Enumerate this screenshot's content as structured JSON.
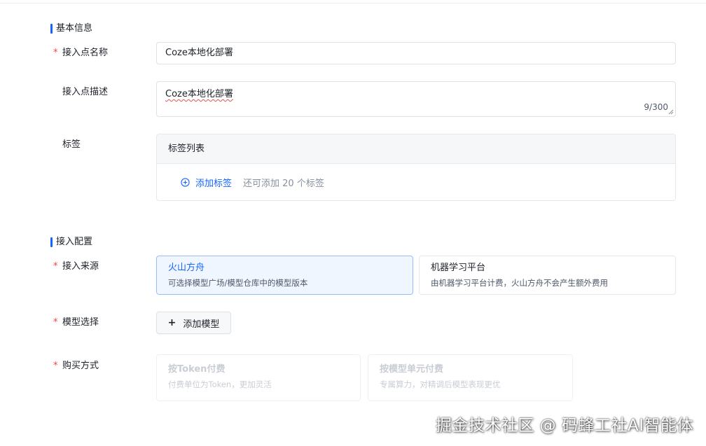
{
  "basic": {
    "section_title": "基本信息",
    "name_label": "接入点名称",
    "name_value": "Coze本地化部署",
    "desc_label": "接入点描述",
    "desc_value": "Coze本地化部署",
    "desc_counter": "9/300",
    "tags_label": "标签",
    "tags_list_header": "标签列表",
    "add_tag_label": "添加标签",
    "tag_hint": "还可添加 20 个标签"
  },
  "config": {
    "section_title": "接入配置",
    "source_label": "接入来源",
    "sources": [
      {
        "title": "火山方舟",
        "desc": "可选择模型广场/模型仓库中的模型版本",
        "selected": true
      },
      {
        "title": "机器学习平台",
        "desc": "由机器学习平台计费，火山方舟不会产生额外费用",
        "selected": false
      }
    ],
    "model_label": "模型选择",
    "add_model_label": "添加模型",
    "purchase_label": "购买方式",
    "purchase_options": [
      {
        "title": "按Token付费",
        "desc": "付费单位为Token，更加灵活",
        "disabled": true
      },
      {
        "title": "按模型单元付费",
        "desc": "专属算力，对精调后模型表现更优",
        "disabled": true
      }
    ]
  },
  "watermark": "掘金技术社区 @ 码蜂工社AI智能体",
  "colors": {
    "accent": "#1664ff",
    "required": "#f53f3f",
    "selected_bg": "#f0f6ff"
  },
  "icons": {
    "add_tag": "plus-circle-icon",
    "add_model": "plus-icon"
  }
}
